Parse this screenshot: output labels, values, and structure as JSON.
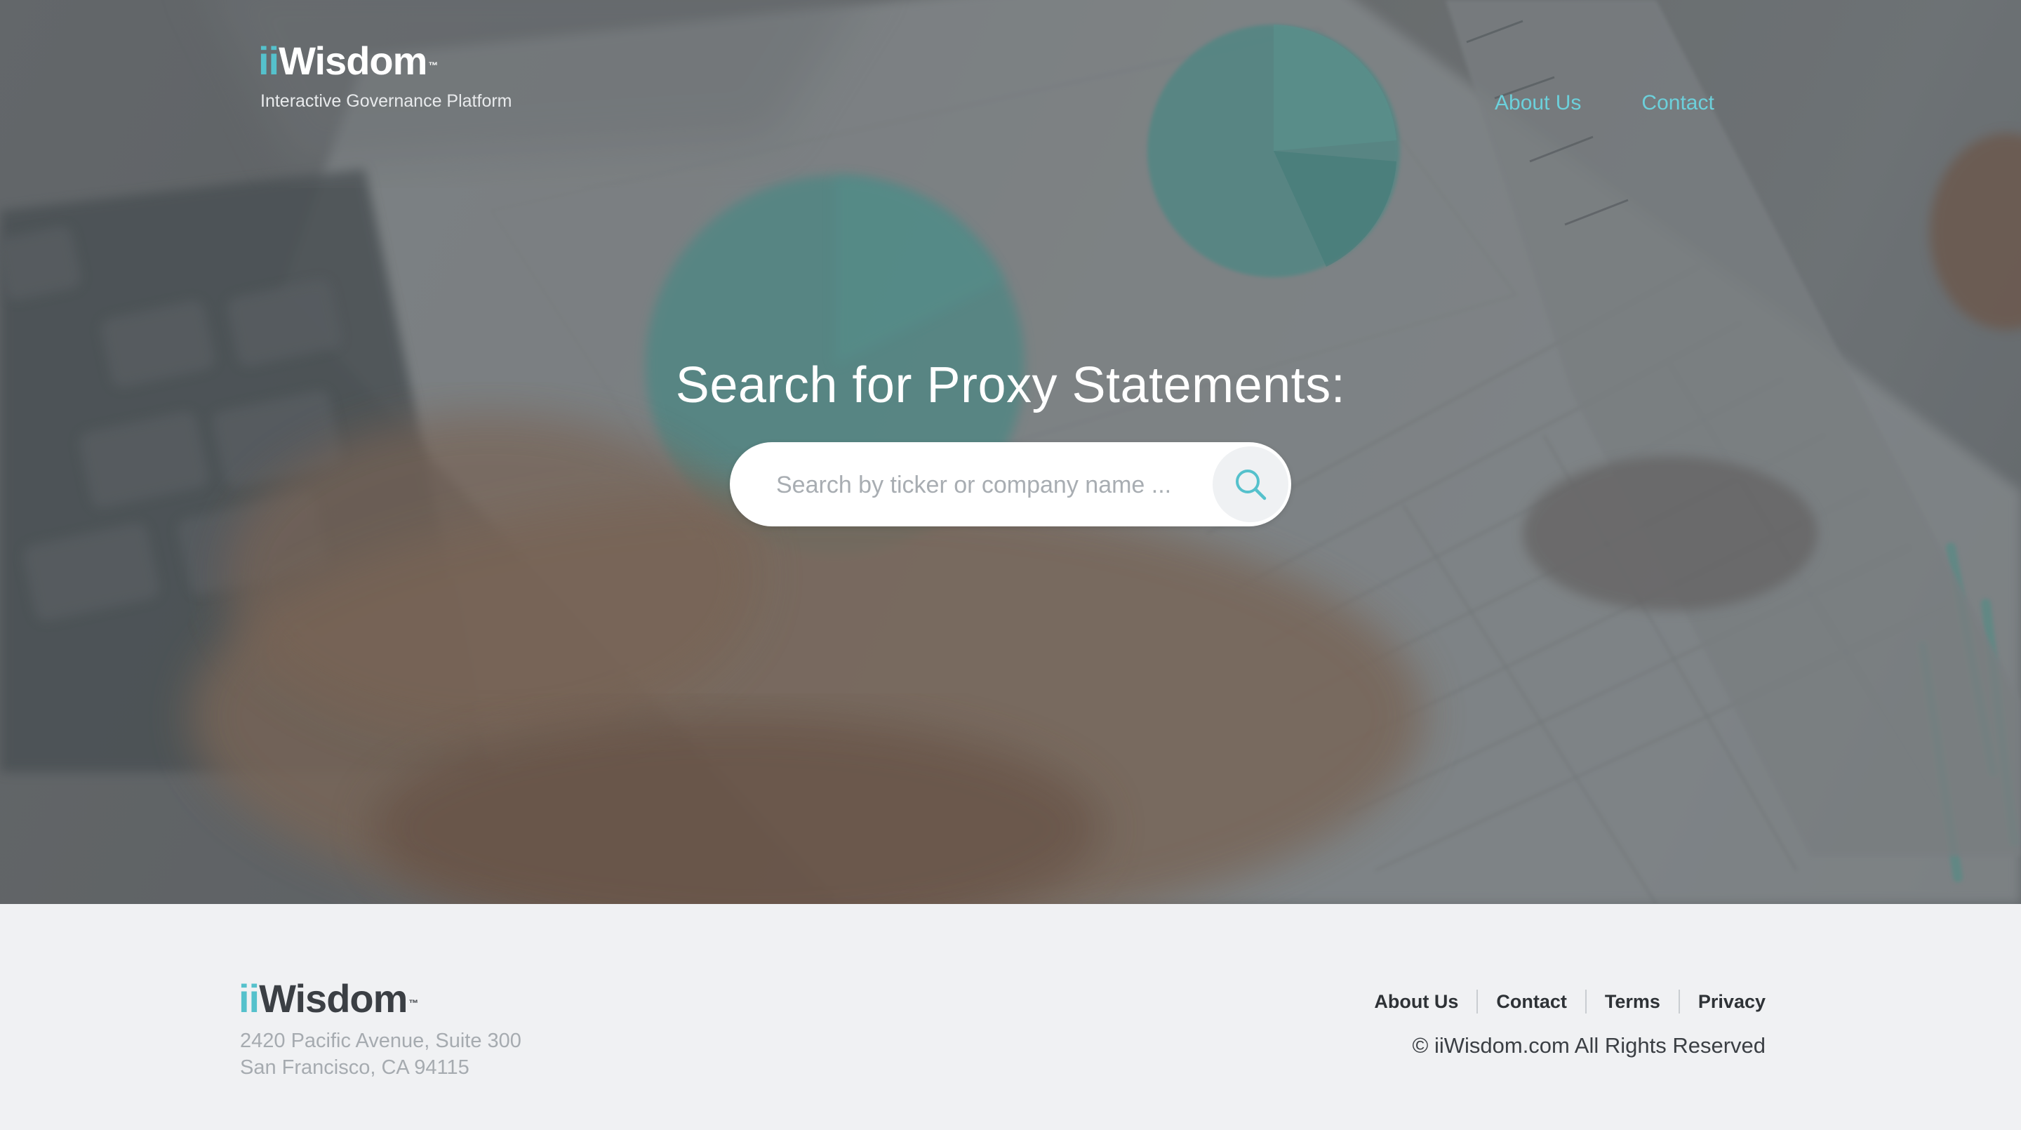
{
  "header": {
    "logo_prefix": "ii",
    "logo_main": "Wisdom",
    "logo_tm": "™",
    "tagline": "Interactive Governance Platform",
    "nav": {
      "about": "About Us",
      "contact": "Contact"
    }
  },
  "hero": {
    "headline": "Search for Proxy Statements:",
    "search": {
      "placeholder": "Search by ticker or company name ...",
      "value": "",
      "button_icon": "search-icon"
    }
  },
  "footer": {
    "logo_prefix": "ii",
    "logo_main": "Wisdom",
    "logo_tm": "™",
    "address_line1": "2420 Pacific Avenue, Suite 300",
    "address_line2": "San Francisco, CA 94115",
    "links": {
      "about": "About Us",
      "contact": "Contact",
      "terms": "Terms",
      "privacy": "Privacy"
    },
    "copyright": "© iiWisdom.com All Rights Reserved"
  },
  "colors": {
    "accent": "#55c1cc",
    "nav_link": "#6cd0db",
    "footer_bg": "#f0f1f3",
    "footer_text": "#3b3f44",
    "address_text": "#a6abb0"
  }
}
